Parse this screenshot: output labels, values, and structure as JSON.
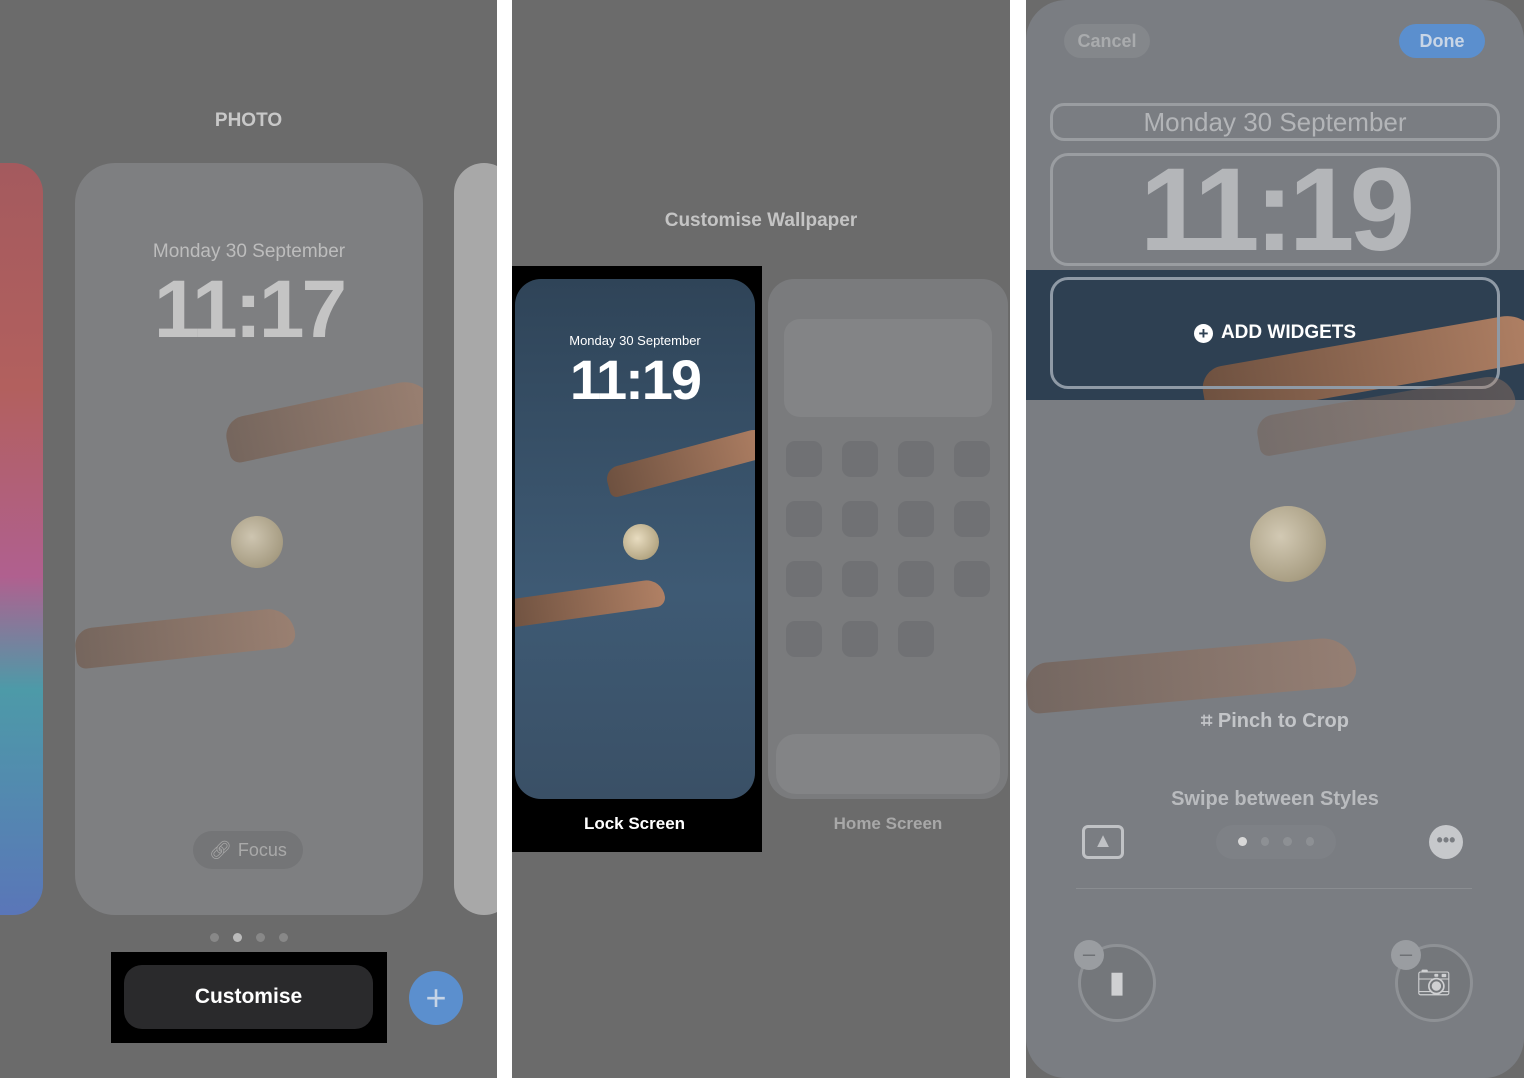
{
  "panel1": {
    "style_label": "PHOTO",
    "date": "Monday 30 September",
    "time": "11:17",
    "focus_label": "Focus",
    "page_dots": 4,
    "active_dot": 2,
    "customise_label": "Customise",
    "add_icon": "plus-icon"
  },
  "panel2": {
    "title": "Customise Wallpaper",
    "lock": {
      "date": "Monday 30 September",
      "time": "11:19",
      "label": "Lock Screen"
    },
    "home": {
      "label": "Home Screen"
    }
  },
  "panel3": {
    "cancel_label": "Cancel",
    "done_label": "Done",
    "date": "Monday 30 September",
    "time": "11:19",
    "add_widgets_label": "ADD WIDGETS",
    "pinch_label": "Pinch to Crop",
    "swipe_label": "Swipe between Styles",
    "style_dots": 4,
    "active_dot": 1,
    "left_icon": "flashlight-icon",
    "right_icon": "camera-icon"
  },
  "colors": {
    "accent": "#5b8fce",
    "background": "#6b6b6b",
    "highlight": "#000000"
  }
}
